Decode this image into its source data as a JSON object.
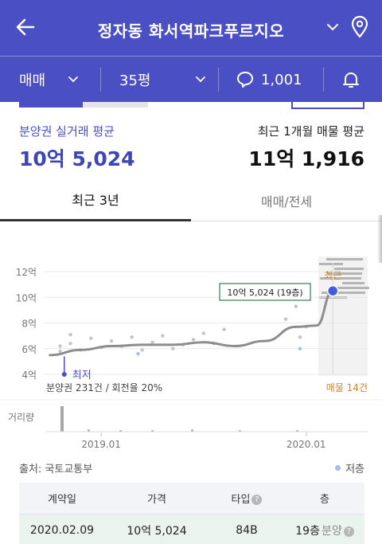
{
  "header": {
    "title": "정자동 화서역파크푸르지오",
    "icons": {
      "back": "arrow-left",
      "dropdown": "chevron-down",
      "location": "map-pin"
    }
  },
  "filters": {
    "deal_type": "매매",
    "size": "35평",
    "comment_count": "1,001"
  },
  "stats": {
    "left_label": "분양권 실거래 평균",
    "left_value": "10억 5,024",
    "right_label": "최근 1개월 매물 평균",
    "right_value": "11억 1,916"
  },
  "tabs": [
    {
      "label": "최근 3년",
      "active": true
    },
    {
      "label": "매매/전세",
      "active": false
    }
  ],
  "chart_data": {
    "type": "line",
    "y_ticks": [
      "12억",
      "10억",
      "8억",
      "6억",
      "4억"
    ],
    "ylim": [
      4,
      12
    ],
    "x_labels": [
      "2019.01",
      "2020.01"
    ],
    "series_line": {
      "x": [
        2018.75,
        2018.9,
        2019.05,
        2019.2,
        2019.35,
        2019.5,
        2019.65,
        2019.8,
        2019.95,
        2020.05,
        2020.13
      ],
      "y": [
        5.5,
        5.9,
        6.2,
        6.3,
        6.3,
        6.5,
        6.2,
        6.6,
        7.7,
        7.8,
        10.5
      ]
    },
    "scatter": {
      "x": [
        2018.8,
        2018.8,
        2018.85,
        2018.85,
        2018.9,
        2018.95,
        2019.0,
        2019.05,
        2019.1,
        2019.15,
        2019.2,
        2019.25,
        2019.3,
        2019.35,
        2019.4,
        2019.45,
        2019.5,
        2019.55,
        2019.6,
        2019.9,
        2019.95,
        2019.97,
        2020.0
      ],
      "y": [
        5.8,
        6.2,
        6.4,
        7.1,
        5.9,
        6.8,
        6.1,
        6.6,
        6.2,
        6.9,
        5.9,
        6.5,
        7.0,
        6.0,
        6.3,
        6.7,
        7.2,
        6.4,
        7.5,
        8.3,
        9.3,
        6.9,
        7.7
      ]
    },
    "latest_label": "최근",
    "latest_annotation": "10억 5,024 (19층)",
    "lowest_label": "최저",
    "footer_left": "분양권 231건 / 회전율 20%",
    "footer_right": "매물 14건",
    "volume_label": "거리량",
    "colors": {
      "line": "#8d8d8d",
      "scatter": "#c4c4c4",
      "accent": "#4a4fc4",
      "listing": "#d2842e",
      "annotation_border": "#3f8a5b"
    }
  },
  "source": "출처: 국토교통부",
  "legend_low": "저층",
  "table": {
    "headers": [
      "계약일",
      "가격",
      "타입",
      "층"
    ],
    "rows": [
      {
        "date": "2020.02.09",
        "price": "10억 5,024",
        "type": "84B",
        "floor": "19층",
        "note": "분양"
      }
    ]
  }
}
